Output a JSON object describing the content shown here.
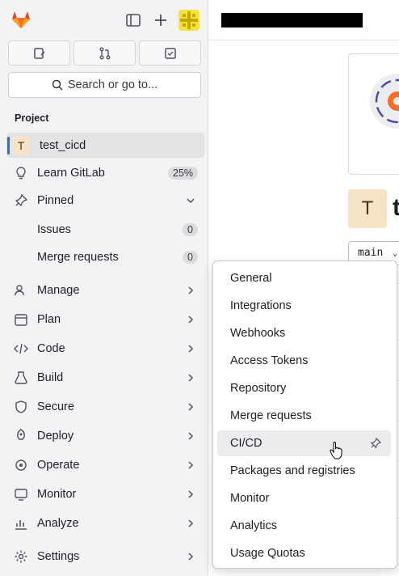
{
  "topbar": {
    "logo_icon": "gitlab-tanuki-icon",
    "toggle_icon": "sidebar-toggle-icon",
    "new_icon": "plus-icon",
    "avatar_icon": "user-avatar-icon",
    "shortcuts": [
      "issues-icon",
      "merge-requests-icon",
      "todos-icon"
    ]
  },
  "search": {
    "label": "Search or go to..."
  },
  "sidebar": {
    "section_title": "Project",
    "project": {
      "initial": "T",
      "name": "test_cicd"
    },
    "learn": {
      "label": "Learn GitLab",
      "badge": "25%"
    },
    "pinned": {
      "label": "Pinned"
    },
    "pinned_items": [
      {
        "label": "Issues",
        "count": "0"
      },
      {
        "label": "Merge requests",
        "count": "0"
      }
    ],
    "nav": [
      {
        "label": "Manage",
        "icon": "manage-icon"
      },
      {
        "label": "Plan",
        "icon": "plan-icon"
      },
      {
        "label": "Code",
        "icon": "code-icon"
      },
      {
        "label": "Build",
        "icon": "build-icon"
      },
      {
        "label": "Secure",
        "icon": "shield-icon"
      },
      {
        "label": "Deploy",
        "icon": "deploy-icon"
      },
      {
        "label": "Operate",
        "icon": "operate-icon"
      },
      {
        "label": "Monitor",
        "icon": "monitor-icon"
      },
      {
        "label": "Analyze",
        "icon": "analyze-icon"
      },
      {
        "label": "Settings",
        "icon": "gear-icon"
      }
    ]
  },
  "main": {
    "project_initial": "T",
    "title_partial": "t",
    "branch": "main"
  },
  "settings_menu": {
    "items": [
      "General",
      "Integrations",
      "Webhooks",
      "Access Tokens",
      "Repository",
      "Merge requests",
      "CI/CD",
      "Packages and registries",
      "Monitor",
      "Analytics",
      "Usage Quotas"
    ],
    "active": "CI/CD"
  },
  "colors": {
    "accent": "#1f75cb",
    "sidebar_bg": "#f3f3f5",
    "active_bg": "#e3e3e6"
  }
}
